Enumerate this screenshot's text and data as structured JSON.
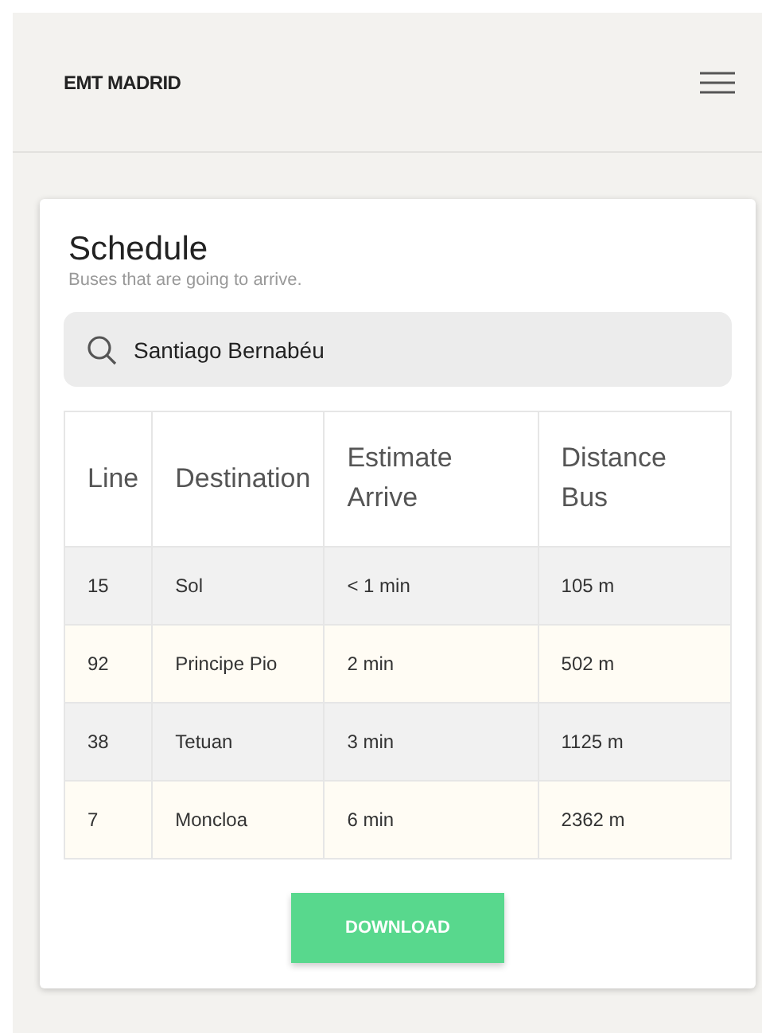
{
  "header": {
    "brand": "EMT MADRID"
  },
  "schedule": {
    "title": "Schedule",
    "subtitle": "Buses that are going to arrive.",
    "search": {
      "value": "Santiago Bernabéu"
    },
    "table": {
      "columns": [
        "Line",
        "Destination",
        "Estimate Arrive",
        "Distance Bus"
      ],
      "rows": [
        [
          "15",
          "Sol",
          "< 1 min",
          "105 m"
        ],
        [
          "92",
          "Principe Pio",
          "2 min",
          "502 m"
        ],
        [
          "38",
          "Tetuan",
          "3 min",
          "1125 m"
        ],
        [
          "7",
          "Moncloa",
          "6 min",
          "2362 m"
        ]
      ]
    },
    "button": "DOWNLOAD"
  }
}
